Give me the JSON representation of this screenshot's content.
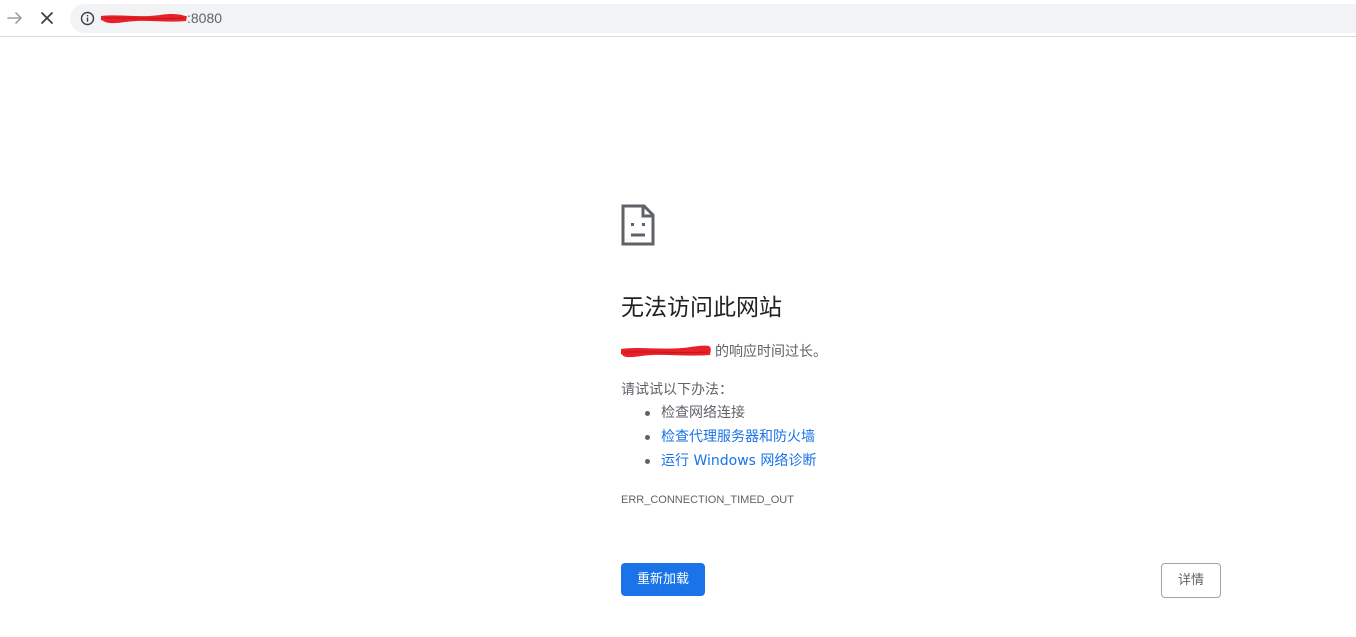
{
  "toolbar": {
    "url_visible_suffix": ":8080"
  },
  "error": {
    "title": "无法访问此网站",
    "summary_suffix": "的响应时间过长。",
    "suggestions_heading": "请试试以下办法：",
    "suggestions": [
      {
        "text": "检查网络连接",
        "is_link": false
      },
      {
        "text": "检查代理服务器和防火墙",
        "is_link": true
      },
      {
        "text": "运行 Windows 网络诊断",
        "is_link": true
      }
    ],
    "code": "ERR_CONNECTION_TIMED_OUT"
  },
  "buttons": {
    "reload_label": "重新加载",
    "details_label": "详情"
  },
  "colors": {
    "accent": "#1a73e8",
    "redaction": "#e8202a",
    "text_secondary": "#5f6368"
  },
  "icons": {
    "forward": "forward-arrow-icon",
    "stop": "stop-loading-icon",
    "site_info": "info-icon",
    "error_page": "sad-page-icon"
  }
}
